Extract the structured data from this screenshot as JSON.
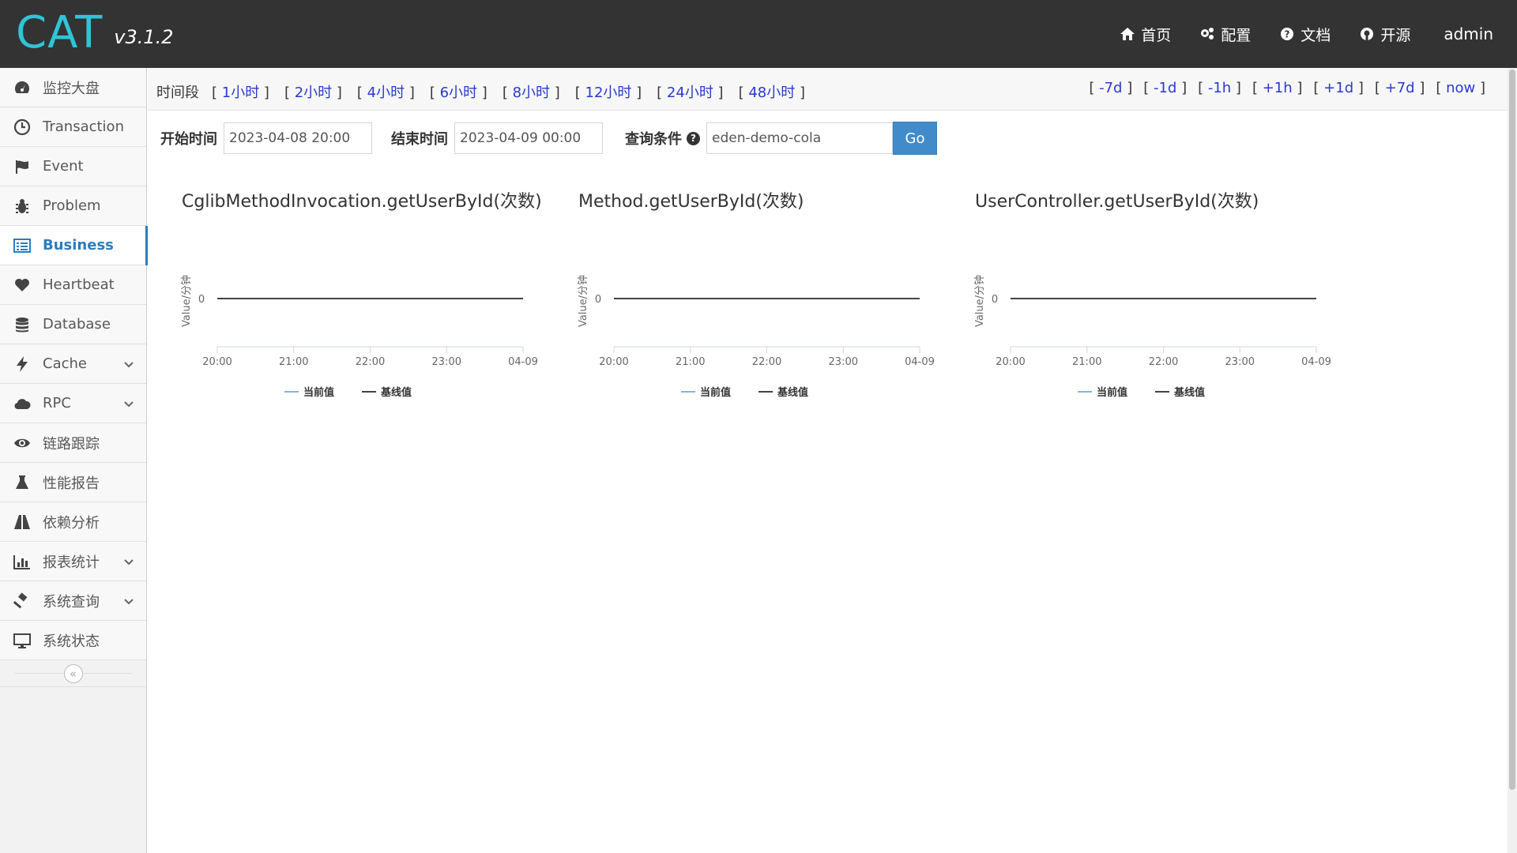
{
  "header": {
    "logo": "CAT",
    "version": "v3.1.2",
    "nav": [
      {
        "label": "首页",
        "icon": "home-icon"
      },
      {
        "label": "配置",
        "icon": "cogs-icon"
      },
      {
        "label": "文档",
        "icon": "question-circle-icon"
      },
      {
        "label": "开源",
        "icon": "github-icon"
      }
    ],
    "user": "admin"
  },
  "sidebar": {
    "items": [
      {
        "label": "监控大盘",
        "icon": "dashboard-icon",
        "has_children": false,
        "active": false
      },
      {
        "label": "Transaction",
        "icon": "clock-icon",
        "has_children": false,
        "active": false
      },
      {
        "label": "Event",
        "icon": "flag-icon",
        "has_children": false,
        "active": false
      },
      {
        "label": "Problem",
        "icon": "bug-icon",
        "has_children": false,
        "active": false
      },
      {
        "label": "Business",
        "icon": "list-icon",
        "has_children": false,
        "active": true
      },
      {
        "label": "Heartbeat",
        "icon": "heart-icon",
        "has_children": false,
        "active": false
      },
      {
        "label": "Database",
        "icon": "database-icon",
        "has_children": false,
        "active": false
      },
      {
        "label": "Cache",
        "icon": "bolt-icon",
        "has_children": true,
        "active": false
      },
      {
        "label": "RPC",
        "icon": "cloud-icon",
        "has_children": true,
        "active": false
      },
      {
        "label": "链路跟踪",
        "icon": "eye-icon",
        "has_children": false,
        "active": false
      },
      {
        "label": "性能报告",
        "icon": "flask-icon",
        "has_children": false,
        "active": false
      },
      {
        "label": "依赖分析",
        "icon": "road-icon",
        "has_children": false,
        "active": false
      },
      {
        "label": "报表统计",
        "icon": "bar-chart-icon",
        "has_children": true,
        "active": false
      },
      {
        "label": "系统查询",
        "icon": "gavel-icon",
        "has_children": true,
        "active": false
      },
      {
        "label": "系统状态",
        "icon": "desktop-icon",
        "has_children": false,
        "active": false
      }
    ],
    "collapse_glyph": "«"
  },
  "timebar": {
    "label": "时间段",
    "ranges": [
      "1小时",
      "2小时",
      "4小时",
      "6小时",
      "8小时",
      "12小时",
      "24小时",
      "48小时"
    ],
    "shifts": [
      "-7d",
      "-1d",
      "-1h",
      "+1h",
      "+1d",
      "+7d",
      "now"
    ]
  },
  "query": {
    "start_label": "开始时间",
    "start_value": "2023-04-08 20:00",
    "end_label": "结束时间",
    "end_value": "2023-04-09 00:00",
    "condition_label": "查询条件",
    "condition_value": "eden-demo-cola",
    "go_label": "Go"
  },
  "colors": {
    "current": "#7cb5ec",
    "baseline": "#434348",
    "accent": "#2b7dbc",
    "header_bg": "#333333",
    "logo": "#2fc4d8"
  },
  "chart_data": [
    {
      "type": "line",
      "title": "CglibMethodInvocation.getUserById(次数)",
      "ylabel": "Value/分钟",
      "yticks": [
        "0"
      ],
      "x_ticks": [
        "20:00",
        "21:00",
        "22:00",
        "23:00",
        "04-09"
      ],
      "series": [
        {
          "name": "当前值",
          "values": [
            0,
            0,
            0,
            0,
            0
          ]
        },
        {
          "name": "基线值",
          "values": [
            0,
            0,
            0,
            0,
            0
          ]
        }
      ]
    },
    {
      "type": "line",
      "title": "Method.getUserById(次数)",
      "ylabel": "Value/分钟",
      "yticks": [
        "0"
      ],
      "x_ticks": [
        "20:00",
        "21:00",
        "22:00",
        "23:00",
        "04-09"
      ],
      "series": [
        {
          "name": "当前值",
          "values": [
            0,
            0,
            0,
            0,
            0
          ]
        },
        {
          "name": "基线值",
          "values": [
            0,
            0,
            0,
            0,
            0
          ]
        }
      ]
    },
    {
      "type": "line",
      "title": "UserController.getUserById(次数)",
      "ylabel": "Value/分钟",
      "yticks": [
        "0"
      ],
      "x_ticks": [
        "20:00",
        "21:00",
        "22:00",
        "23:00",
        "04-09"
      ],
      "series": [
        {
          "name": "当前值",
          "values": [
            0,
            0,
            0,
            0,
            0
          ]
        },
        {
          "name": "基线值",
          "values": [
            0,
            0,
            0,
            0,
            0
          ]
        }
      ]
    }
  ]
}
